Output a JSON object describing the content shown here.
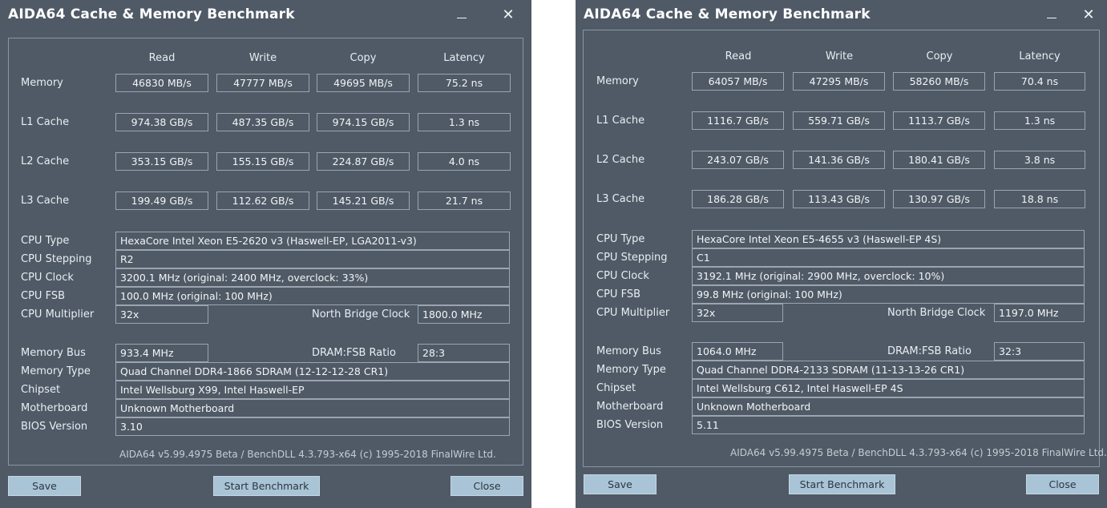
{
  "windows": [
    {
      "title": "AIDA64 Cache & Memory Benchmark",
      "headers": [
        "Read",
        "Write",
        "Copy",
        "Latency"
      ],
      "rows": [
        {
          "label": "Memory",
          "values": [
            "46830 MB/s",
            "47777 MB/s",
            "49695 MB/s",
            "75.2 ns"
          ]
        },
        {
          "label": "L1 Cache",
          "values": [
            "974.38 GB/s",
            "487.35 GB/s",
            "974.15 GB/s",
            "1.3 ns"
          ]
        },
        {
          "label": "L2 Cache",
          "values": [
            "353.15 GB/s",
            "155.15 GB/s",
            "224.87 GB/s",
            "4.0 ns"
          ]
        },
        {
          "label": "L3 Cache",
          "values": [
            "199.49 GB/s",
            "112.62 GB/s",
            "145.21 GB/s",
            "21.7 ns"
          ]
        }
      ],
      "info": {
        "cpu_type_label": "CPU Type",
        "cpu_type": "HexaCore Intel Xeon E5-2620 v3  (Haswell-EP, LGA2011-v3)",
        "cpu_stepping_label": "CPU Stepping",
        "cpu_stepping": "R2",
        "cpu_clock_label": "CPU Clock",
        "cpu_clock": "3200.1 MHz  (original: 2400 MHz, overclock: 33%)",
        "cpu_fsb_label": "CPU FSB",
        "cpu_fsb": "100.0 MHz  (original: 100 MHz)",
        "cpu_multiplier_label": "CPU Multiplier",
        "cpu_multiplier": "32x",
        "nb_clock_label": "North Bridge Clock",
        "nb_clock": "1800.0 MHz",
        "memory_bus_label": "Memory Bus",
        "memory_bus": "933.4 MHz",
        "dram_ratio_label": "DRAM:FSB Ratio",
        "dram_ratio": "28:3",
        "memory_type_label": "Memory Type",
        "memory_type": "Quad Channel DDR4-1866 SDRAM  (12-12-12-28 CR1)",
        "chipset_label": "Chipset",
        "chipset": "Intel Wellsburg X99, Intel Haswell-EP",
        "motherboard_label": "Motherboard",
        "motherboard": "Unknown Motherboard",
        "bios_label": "BIOS Version",
        "bios": "3.10"
      },
      "footer": "AIDA64 v5.99.4975 Beta / BenchDLL 4.3.793-x64  (c) 1995-2018 FinalWire Ltd.",
      "buttons": {
        "save": "Save",
        "start": "Start Benchmark",
        "close": "Close"
      },
      "close_glyph": "✕"
    },
    {
      "title": "AIDA64 Cache & Memory Benchmark",
      "headers": [
        "Read",
        "Write",
        "Copy",
        "Latency"
      ],
      "rows": [
        {
          "label": "Memory",
          "values": [
            "64057 MB/s",
            "47295 MB/s",
            "58260 MB/s",
            "70.4 ns"
          ]
        },
        {
          "label": "L1 Cache",
          "values": [
            "1116.7 GB/s",
            "559.71 GB/s",
            "1113.7 GB/s",
            "1.3 ns"
          ]
        },
        {
          "label": "L2 Cache",
          "values": [
            "243.07 GB/s",
            "141.36 GB/s",
            "180.41 GB/s",
            "3.8 ns"
          ]
        },
        {
          "label": "L3 Cache",
          "values": [
            "186.28 GB/s",
            "113.43 GB/s",
            "130.97 GB/s",
            "18.8 ns"
          ]
        }
      ],
      "info": {
        "cpu_type_label": "CPU Type",
        "cpu_type": "HexaCore Intel Xeon E5-4655 v3  (Haswell-EP 4S)",
        "cpu_stepping_label": "CPU Stepping",
        "cpu_stepping": "C1",
        "cpu_clock_label": "CPU Clock",
        "cpu_clock": "3192.1 MHz  (original: 2900 MHz, overclock: 10%)",
        "cpu_fsb_label": "CPU FSB",
        "cpu_fsb": "99.8 MHz  (original: 100 MHz)",
        "cpu_multiplier_label": "CPU Multiplier",
        "cpu_multiplier": "32x",
        "nb_clock_label": "North Bridge Clock",
        "nb_clock": "1197.0 MHz",
        "memory_bus_label": "Memory Bus",
        "memory_bus": "1064.0 MHz",
        "dram_ratio_label": "DRAM:FSB Ratio",
        "dram_ratio": "32:3",
        "memory_type_label": "Memory Type",
        "memory_type": "Quad Channel DDR4-2133 SDRAM  (11-13-13-26 CR1)",
        "chipset_label": "Chipset",
        "chipset": "Intel Wellsburg C612, Intel Haswell-EP 4S",
        "motherboard_label": "Motherboard",
        "motherboard": "Unknown Motherboard",
        "bios_label": "BIOS Version",
        "bios": "5.11"
      },
      "footer": "AIDA64 v5.99.4975 Beta / BenchDLL 4.3.793-x64  (c) 1995-2018 FinalWire Ltd.",
      "buttons": {
        "save": "Save",
        "start": "Start Benchmark",
        "close": "Close"
      },
      "close_glyph": "✕"
    }
  ],
  "colors": {
    "window_bg": "#4f5a66",
    "button_bg": "#a9c4d6",
    "text": "#e8edf2"
  },
  "icons": {
    "minimize": "minimize-icon",
    "close": "close-icon"
  }
}
